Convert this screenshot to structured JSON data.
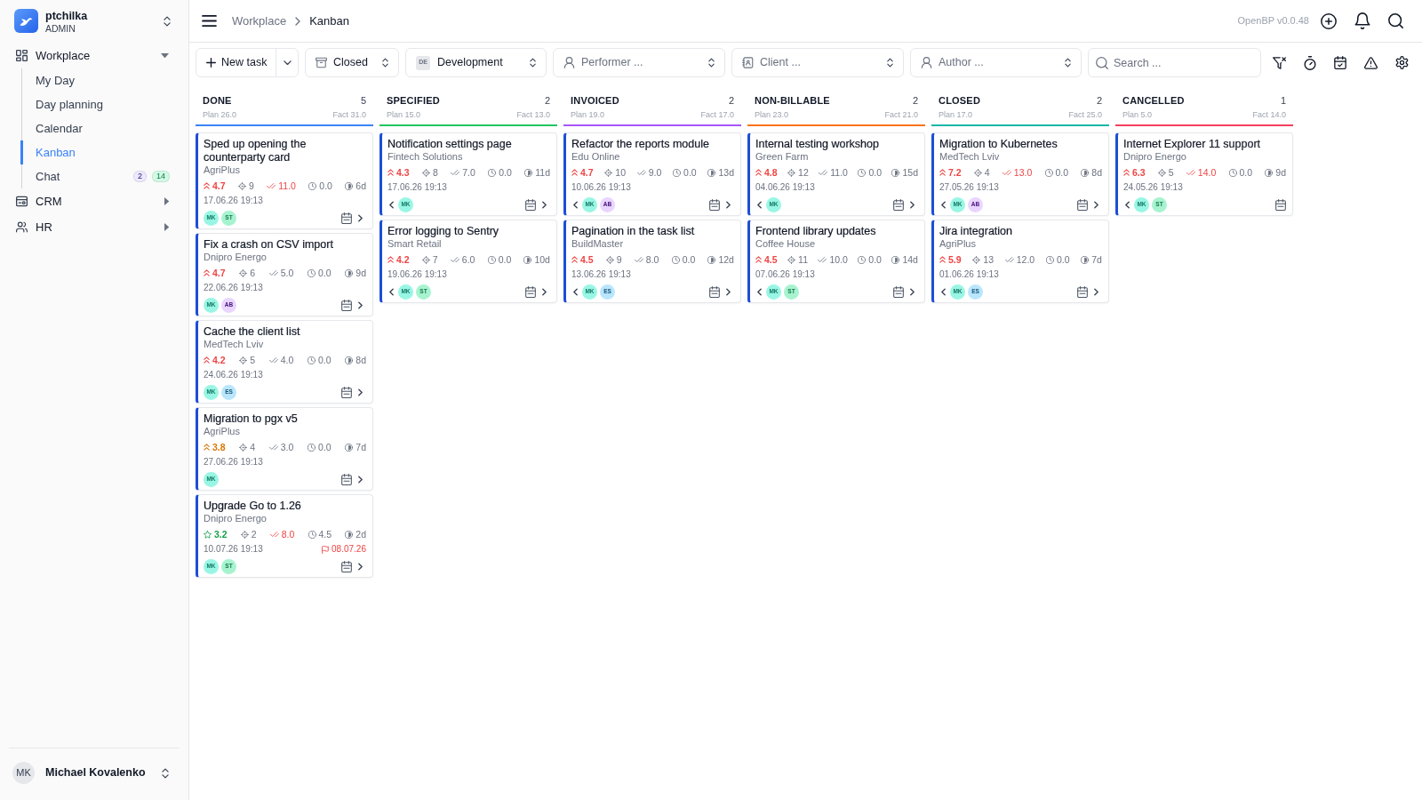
{
  "sidebar": {
    "workspace": {
      "name": "ptchilka",
      "role": "ADMIN"
    },
    "items": [
      {
        "label": "Workplace",
        "selected": false,
        "expanded": true,
        "children": [
          {
            "label": "My Day",
            "selected": false
          },
          {
            "label": "Day planning",
            "selected": false
          },
          {
            "label": "Calendar",
            "selected": false
          },
          {
            "label": "Kanban",
            "selected": true
          },
          {
            "label": "Chat",
            "selected": false,
            "badges": [
              {
                "text": "2",
                "color": "#ede9fe"
              },
              {
                "text": "14",
                "color": "#d1fae5"
              }
            ]
          }
        ]
      },
      {
        "label": "CRM",
        "selected": false,
        "expanded": false
      },
      {
        "label": "HR",
        "selected": false,
        "expanded": false
      }
    ],
    "user": {
      "initials": "MK",
      "name": "Michael Kovalenko"
    }
  },
  "header": {
    "breadcrumb": [
      "Workplace",
      "Kanban"
    ],
    "version": "OpenBP v0.0.48"
  },
  "toolbar": {
    "new_task": "New task",
    "filters": [
      {
        "value": "Closed"
      },
      {
        "tag": "DE",
        "value": "Development"
      },
      {
        "placeholder": "Performer ..."
      },
      {
        "placeholder": "Client ..."
      },
      {
        "placeholder": "Author ..."
      }
    ],
    "search": {
      "placeholder": "Search ..."
    }
  },
  "columns": [
    {
      "title": "DONE",
      "count": "5",
      "plan": "Plan 26.0",
      "fact": "Fact 31.0",
      "color": "#3b82f6",
      "cards": [
        {
          "title": "Sped up opening the counterparty card",
          "client": "AgriPlus",
          "priority": {
            "value": "4.7",
            "kind": "high"
          },
          "targets": "9",
          "done": {
            "value": "11.0",
            "over": true
          },
          "time": "0.0",
          "days": "6d",
          "date": "17.06.26 19:13",
          "assignees": [
            {
              "initials": "MK",
              "color": "#99f6e4"
            },
            {
              "initials": "ST",
              "color": "#a7f3d0"
            }
          ],
          "prev": false,
          "next": true
        },
        {
          "title": "Fix a crash on CSV import",
          "client": "Dnipro Energo",
          "priority": {
            "value": "4.7",
            "kind": "high"
          },
          "targets": "6",
          "done": {
            "value": "5.0",
            "over": false
          },
          "time": "0.0",
          "days": "9d",
          "date": "22.06.26 19:13",
          "assignees": [
            {
              "initials": "MK",
              "color": "#99f6e4"
            },
            {
              "initials": "AB",
              "color": "#e9d5ff"
            }
          ],
          "prev": false,
          "next": true
        },
        {
          "title": "Cache the client list",
          "client": "MedTech Lviv",
          "priority": {
            "value": "4.2",
            "kind": "high"
          },
          "targets": "5",
          "done": {
            "value": "4.0",
            "over": false
          },
          "time": "0.0",
          "days": "8d",
          "date": "24.06.26 19:13",
          "assignees": [
            {
              "initials": "MK",
              "color": "#99f6e4"
            },
            {
              "initials": "ES",
              "color": "#bae6fd"
            }
          ],
          "prev": false,
          "next": true
        },
        {
          "title": "Migration to pgx v5",
          "client": "AgriPlus",
          "priority": {
            "value": "3.8",
            "kind": "medium"
          },
          "targets": "4",
          "done": {
            "value": "3.0",
            "over": false
          },
          "time": "0.0",
          "days": "7d",
          "date": "27.06.26 19:13",
          "assignees": [
            {
              "initials": "MK",
              "color": "#99f6e4"
            }
          ],
          "prev": false,
          "next": true
        },
        {
          "title": "Upgrade Go to 1.26",
          "client": "Dnipro Energo",
          "priority": {
            "value": "3.2",
            "kind": "low"
          },
          "targets": "2",
          "done": {
            "value": "8.0",
            "over": true
          },
          "time": "4.5",
          "days": "2d",
          "date": "10.07.26 19:13",
          "deadline": "08.07.26",
          "assignees": [
            {
              "initials": "MK",
              "color": "#99f6e4"
            },
            {
              "initials": "ST",
              "color": "#a7f3d0"
            }
          ],
          "prev": false,
          "next": true
        }
      ]
    },
    {
      "title": "SPECIFIED",
      "count": "2",
      "plan": "Plan 15.0",
      "fact": "Fact 13.0",
      "color": "#22c55e",
      "cards": [
        {
          "title": "Notification settings page",
          "client": "Fintech Solutions",
          "priority": {
            "value": "4.3",
            "kind": "high"
          },
          "targets": "8",
          "done": {
            "value": "7.0",
            "over": false
          },
          "time": "0.0",
          "days": "11d",
          "date": "17.06.26 19:13",
          "assignees": [
            {
              "initials": "MK",
              "color": "#99f6e4"
            }
          ],
          "prev": true,
          "next": true
        },
        {
          "title": "Error logging to Sentry",
          "client": "Smart Retail",
          "priority": {
            "value": "4.2",
            "kind": "high"
          },
          "targets": "7",
          "done": {
            "value": "6.0",
            "over": false
          },
          "time": "0.0",
          "days": "10d",
          "date": "19.06.26 19:13",
          "assignees": [
            {
              "initials": "MK",
              "color": "#99f6e4"
            },
            {
              "initials": "ST",
              "color": "#a7f3d0"
            }
          ],
          "prev": true,
          "next": true
        }
      ]
    },
    {
      "title": "INVOICED",
      "count": "2",
      "plan": "Plan 19.0",
      "fact": "Fact 17.0",
      "color": "#a855f7",
      "cards": [
        {
          "title": "Refactor the reports module",
          "client": "Edu Online",
          "priority": {
            "value": "4.7",
            "kind": "high"
          },
          "targets": "10",
          "done": {
            "value": "9.0",
            "over": false
          },
          "time": "0.0",
          "days": "13d",
          "date": "10.06.26 19:13",
          "assignees": [
            {
              "initials": "MK",
              "color": "#99f6e4"
            },
            {
              "initials": "AB",
              "color": "#e9d5ff"
            }
          ],
          "prev": true,
          "next": true
        },
        {
          "title": "Pagination in the task list",
          "client": "BuildMaster",
          "priority": {
            "value": "4.5",
            "kind": "high"
          },
          "targets": "9",
          "done": {
            "value": "8.0",
            "over": false
          },
          "time": "0.0",
          "days": "12d",
          "date": "13.06.26 19:13",
          "assignees": [
            {
              "initials": "MK",
              "color": "#99f6e4"
            },
            {
              "initials": "ES",
              "color": "#bae6fd"
            }
          ],
          "prev": true,
          "next": true
        }
      ]
    },
    {
      "title": "NON-BILLABLE",
      "count": "2",
      "plan": "Plan 23.0",
      "fact": "Fact 21.0",
      "color": "#f97316",
      "cards": [
        {
          "title": "Internal testing workshop",
          "client": "Green Farm",
          "priority": {
            "value": "4.8",
            "kind": "high"
          },
          "targets": "12",
          "done": {
            "value": "11.0",
            "over": false
          },
          "time": "0.0",
          "days": "15d",
          "date": "04.06.26 19:13",
          "assignees": [
            {
              "initials": "MK",
              "color": "#99f6e4"
            }
          ],
          "prev": true,
          "next": true
        },
        {
          "title": "Frontend library updates",
          "client": "Coffee House",
          "priority": {
            "value": "4.5",
            "kind": "high"
          },
          "targets": "11",
          "done": {
            "value": "10.0",
            "over": false
          },
          "time": "0.0",
          "days": "14d",
          "date": "07.06.26 19:13",
          "assignees": [
            {
              "initials": "MK",
              "color": "#99f6e4"
            },
            {
              "initials": "ST",
              "color": "#a7f3d0"
            }
          ],
          "prev": true,
          "next": true
        }
      ]
    },
    {
      "title": "CLOSED",
      "count": "2",
      "plan": "Plan 17.0",
      "fact": "Fact 25.0",
      "color": "#14b8a6",
      "cards": [
        {
          "title": "Migration to Kubernetes",
          "client": "MedTech Lviv",
          "priority": {
            "value": "7.2",
            "kind": "high"
          },
          "targets": "4",
          "done": {
            "value": "13.0",
            "over": true
          },
          "time": "0.0",
          "days": "8d",
          "date": "27.05.26 19:13",
          "assignees": [
            {
              "initials": "MK",
              "color": "#99f6e4"
            },
            {
              "initials": "AB",
              "color": "#e9d5ff"
            }
          ],
          "prev": true,
          "next": true
        },
        {
          "title": "Jira integration",
          "client": "AgriPlus",
          "priority": {
            "value": "5.9",
            "kind": "high"
          },
          "targets": "13",
          "done": {
            "value": "12.0",
            "over": false
          },
          "time": "0.0",
          "days": "7d",
          "date": "01.06.26 19:13",
          "assignees": [
            {
              "initials": "MK",
              "color": "#99f6e4"
            },
            {
              "initials": "ES",
              "color": "#bae6fd"
            }
          ],
          "prev": true,
          "next": true
        }
      ]
    },
    {
      "title": "CANCELLED",
      "count": "1",
      "plan": "Plan 5.0",
      "fact": "Fact 14.0",
      "color": "#f43f5e",
      "cards": [
        {
          "title": "Internet Explorer 11 support",
          "client": "Dnipro Energo",
          "priority": {
            "value": "6.3",
            "kind": "high"
          },
          "targets": "5",
          "done": {
            "value": "14.0",
            "over": true
          },
          "time": "0.0",
          "days": "9d",
          "date": "24.05.26 19:13",
          "assignees": [
            {
              "initials": "MK",
              "color": "#99f6e4"
            },
            {
              "initials": "ST",
              "color": "#a7f3d0"
            }
          ],
          "prev": true,
          "next": false
        }
      ]
    }
  ]
}
